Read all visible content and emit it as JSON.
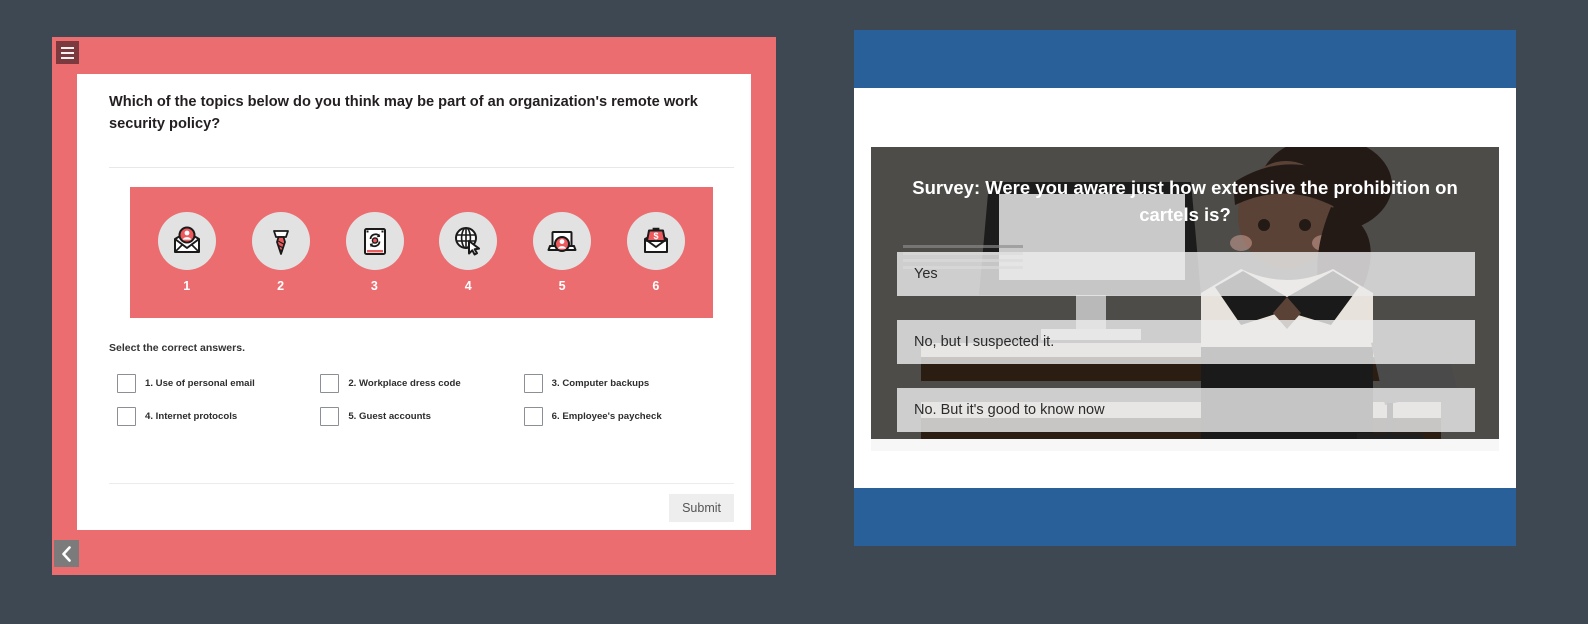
{
  "quiz": {
    "menu_icon": "hamburger-icon",
    "question": "Which of the topics below do you think may be part of an organization's remote work security policy?",
    "icons": [
      {
        "number": "1",
        "icon": "email-person-icon"
      },
      {
        "number": "2",
        "icon": "necktie-icon"
      },
      {
        "number": "3",
        "icon": "hard-drive-backup-icon"
      },
      {
        "number": "4",
        "icon": "globe-cursor-icon"
      },
      {
        "number": "5",
        "icon": "laptop-person-icon"
      },
      {
        "number": "6",
        "icon": "envelope-money-icon"
      }
    ],
    "instruction": "Select the correct answers.",
    "answers": [
      {
        "label": "1. Use of personal email"
      },
      {
        "label": "2. Workplace dress code"
      },
      {
        "label": "3. Computer backups"
      },
      {
        "label": "4. Internet protocols"
      },
      {
        "label": "5. Guest accounts"
      },
      {
        "label": "6. Employee's paycheck"
      }
    ],
    "submit_label": "Submit",
    "back_icon": "chevron-left-icon",
    "accent_color": "#ec6d70"
  },
  "survey": {
    "title": "Survey: Were you aware just how extensive the prohibition on cartels is?",
    "options": [
      {
        "label": "Yes"
      },
      {
        "label": "No, but I suspected it."
      },
      {
        "label": "No. But it's good to know now"
      }
    ],
    "brand_color": "#2a6099",
    "overlay_color": "#4d4c49"
  }
}
